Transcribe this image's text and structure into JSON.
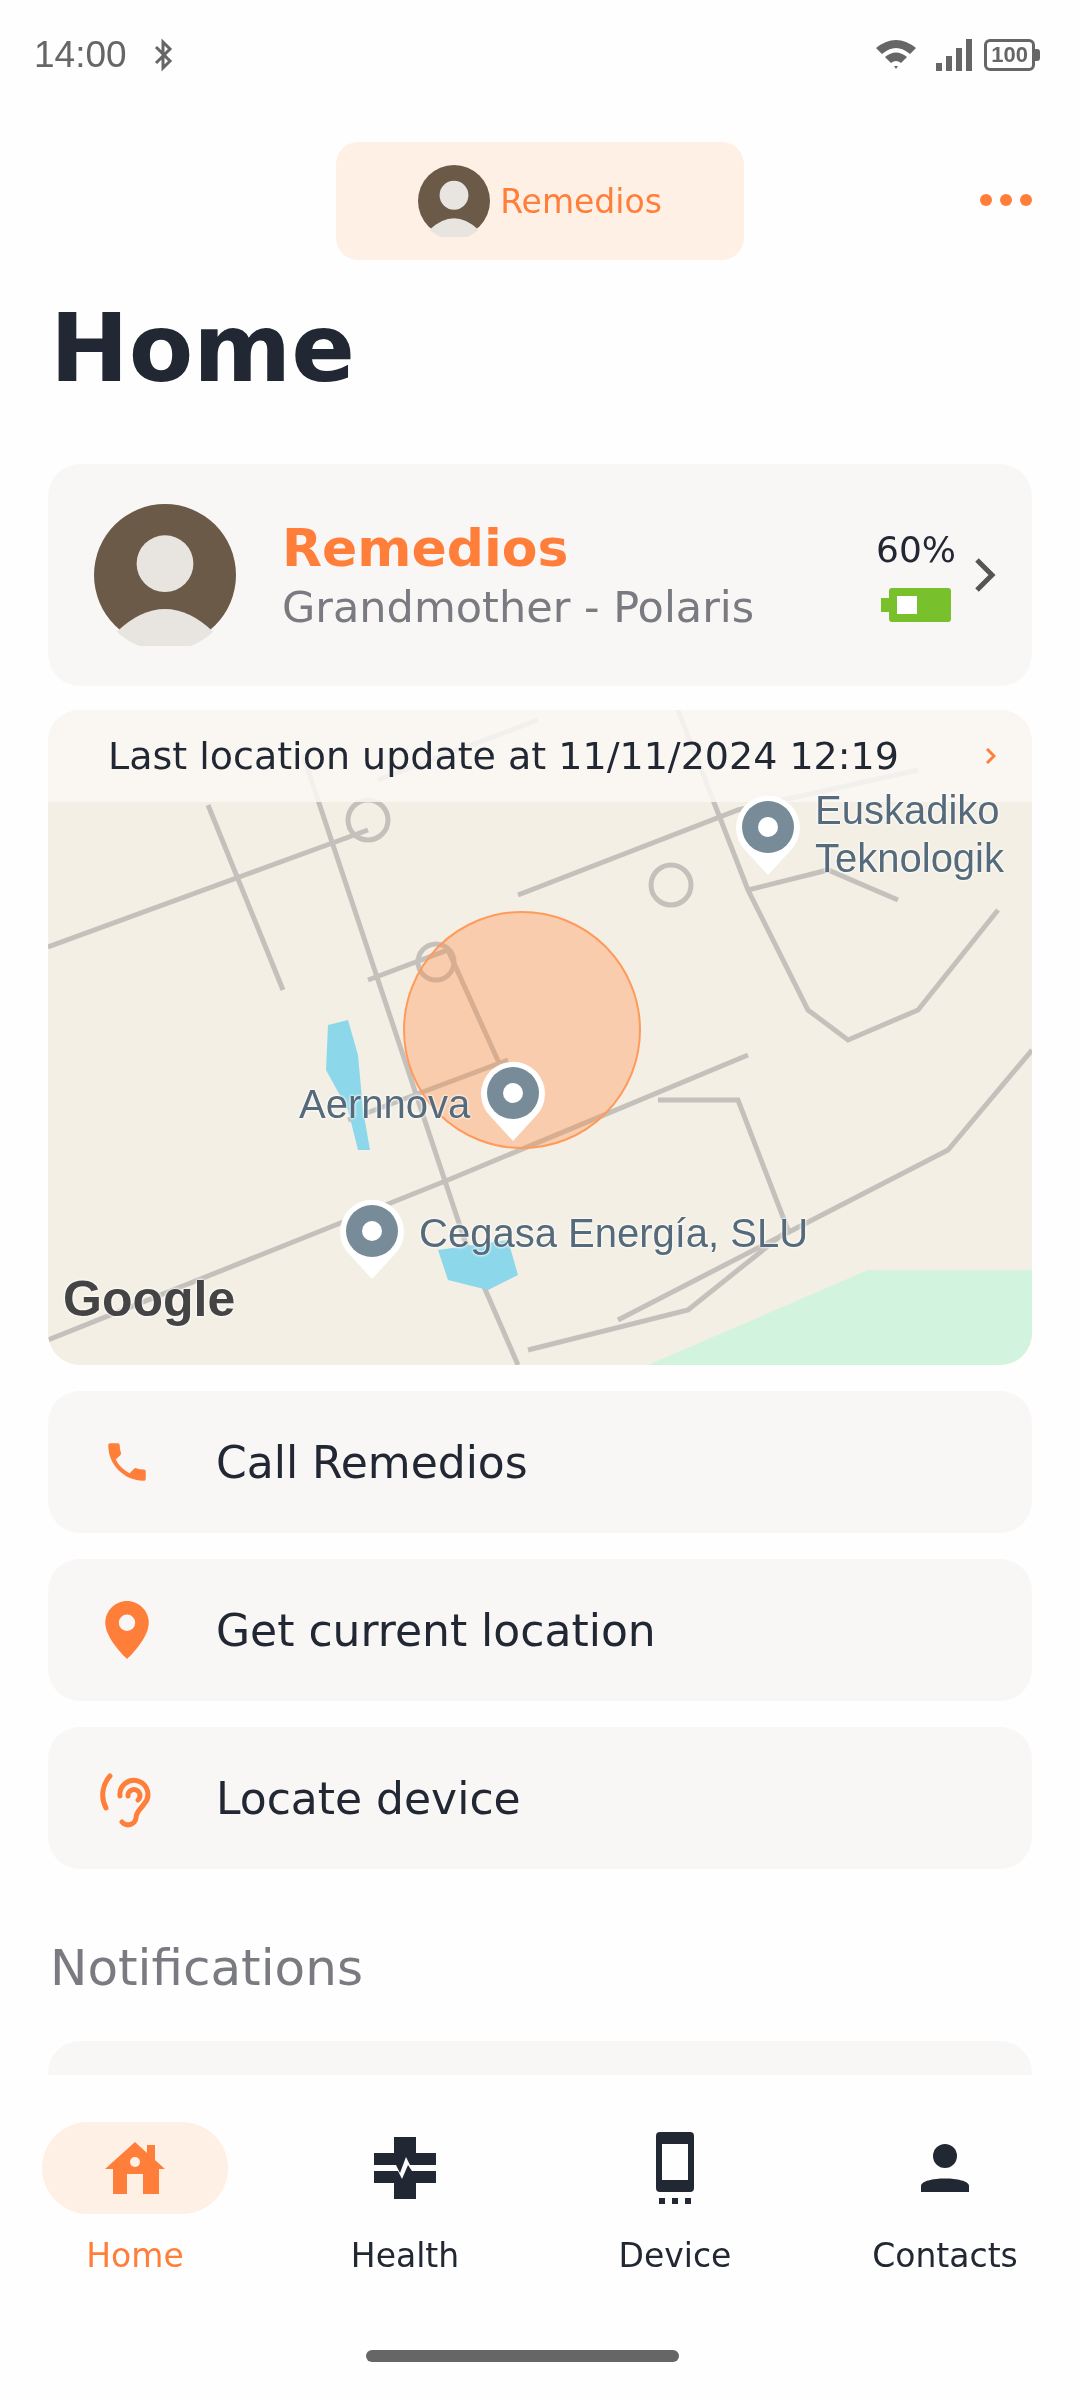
{
  "status_bar": {
    "time": "14:00",
    "battery": "100"
  },
  "header": {
    "name": "Remedios"
  },
  "title": "Home",
  "profile": {
    "name": "Remedios",
    "subtitle": "Grandmother - Polaris",
    "battery_text": "60%"
  },
  "map": {
    "banner": "Last location update at 11/11/2024 12:19",
    "places": [
      {
        "kind": "pin",
        "lines": [
          "Aernnova"
        ]
      },
      {
        "kind": "pin",
        "lines": [
          "Cegasa Energía, SLU"
        ]
      },
      {
        "kind": "pin",
        "lines": [
          "Euskadiko",
          "Teknologik"
        ]
      }
    ],
    "attribution": "Google"
  },
  "actions": [
    {
      "kind": "call",
      "label": "Call Remedios"
    },
    {
      "kind": "location",
      "label": "Get current location"
    },
    {
      "kind": "locate",
      "label": "Locate device"
    }
  ],
  "notifications": {
    "heading": "Notifications"
  },
  "nav": [
    {
      "kind": "home",
      "label": "Home",
      "selected": true
    },
    {
      "kind": "health",
      "label": "Health",
      "selected": false
    },
    {
      "kind": "device",
      "label": "Device",
      "selected": false
    },
    {
      "kind": "contacts",
      "label": "Contacts",
      "selected": false
    }
  ]
}
